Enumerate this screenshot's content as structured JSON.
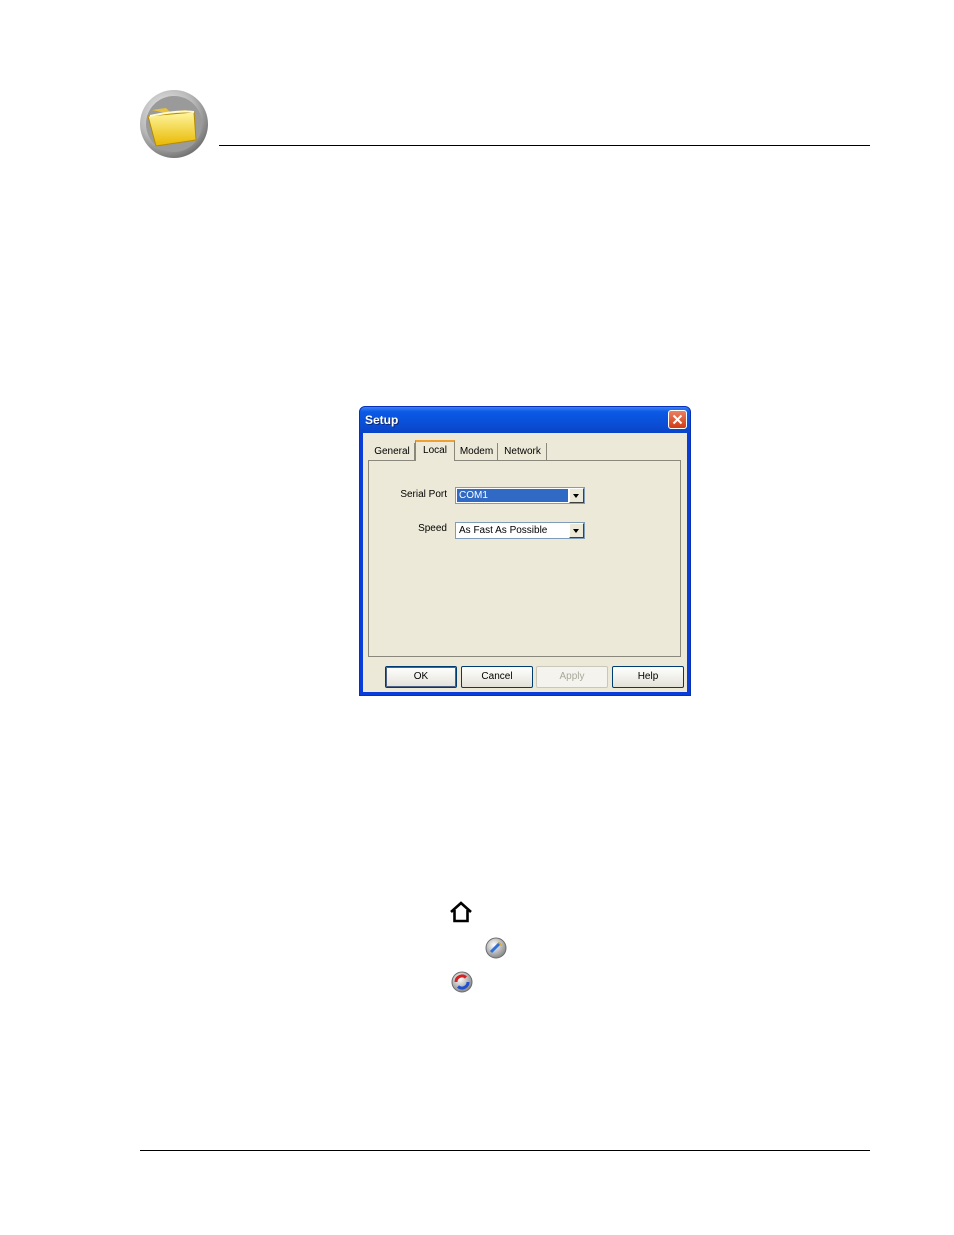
{
  "dialog": {
    "title": "Setup",
    "tabs": [
      {
        "label": "General"
      },
      {
        "label": "Local"
      },
      {
        "label": "Modem"
      },
      {
        "label": "Network"
      }
    ],
    "active_tab": "Local",
    "fields": {
      "serial_port": {
        "label": "Serial Port",
        "value": "COM1"
      },
      "speed": {
        "label": "Speed",
        "value": "As Fast As Possible"
      }
    },
    "buttons": {
      "ok": "OK",
      "cancel": "Cancel",
      "apply": "Apply",
      "help": "Help"
    }
  },
  "icons": [
    "folder-icon",
    "home-icon",
    "tools-icon",
    "hotsync-icon"
  ],
  "colors": {
    "titlebar": "#0a4fd8",
    "selection": "#316ac5",
    "close_button": "#d23a14",
    "dialog_face": "#ece9d8"
  }
}
